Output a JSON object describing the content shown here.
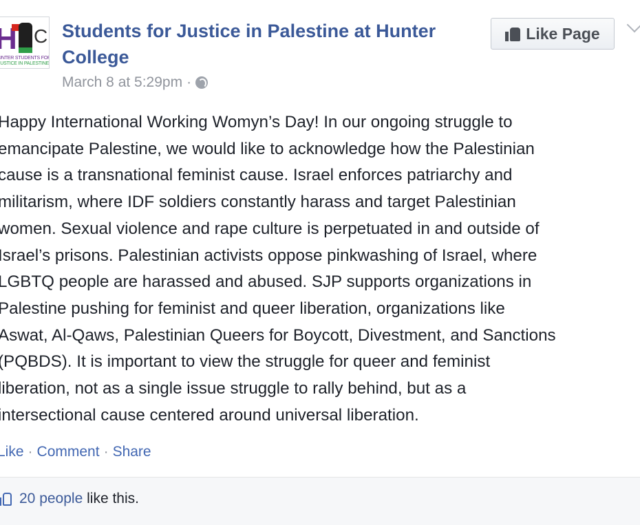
{
  "post": {
    "page_name": "Students for Justice in Palestine at Hunter College",
    "page_name_lines": [
      "Students for Justice in Palestine at Hunter",
      "College"
    ],
    "timestamp": "March 8 at 5:29pm",
    "separator": "·",
    "privacy_icon": "globe-icon",
    "avatar": {
      "logo_letters": [
        "H",
        "C"
      ],
      "caption_line1": "UNTER STUDENTS FOR",
      "caption_line2": "JUSTICE IN PALESTINE"
    },
    "like_page_label": "Like Page",
    "body_lines": [
      "Happy International Working Womyn’s Day! In our ongoing struggle to",
      "emancipate Palestine, we would like to acknowledge how the Palestinian",
      "cause is a transnational feminist cause. Israel enforces patriarchy and",
      "militarism, where IDF soldiers constantly harass and target Palestinian",
      "women. Sexual violence and rape culture is perpetuated in and outside of",
      "Israel’s prisons. Palestinian activists oppose pinkwashing of Israel, where",
      "LGBTQ people are harassed and abused. SJP supports organizations in",
      "Palestine pushing for feminist and queer liberation, organizations like",
      "Aswat, Al-Qaws, Palestinian Queers for Boycott, Divestment, and Sanctions",
      "(PQBDS). It is important to view the struggle for queer and feminist",
      "liberation, not as a single issue struggle to rally behind, but as a",
      "intersectional cause centered around universal liberation."
    ],
    "actions": {
      "like": "Like",
      "comment": "Comment",
      "share": "Share",
      "separator": "·"
    },
    "likes": {
      "count_text": "20 people",
      "suffix": "like this."
    }
  },
  "colors": {
    "link": "#3b5998",
    "action_link": "#4267b2",
    "meta": "#90949c",
    "text": "#1d2129"
  }
}
